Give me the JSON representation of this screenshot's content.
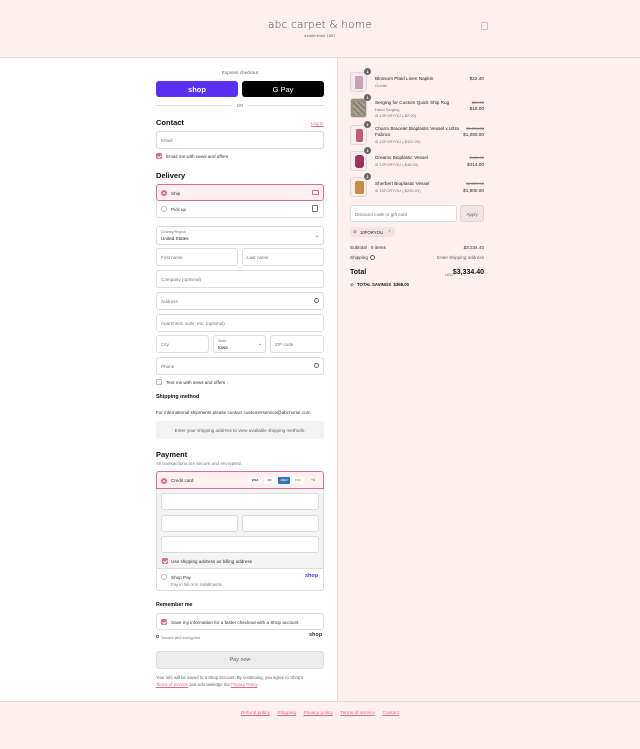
{
  "header": {
    "logo": "abc carpet & home",
    "tagline": "established 1897",
    "bag_icon": "bag-icon"
  },
  "express": {
    "title": "Express checkout",
    "shop_label": "shop",
    "gpay_label": "G Pay",
    "or_label": "OR"
  },
  "contact": {
    "title": "Contact",
    "login": "Log in",
    "email_placeholder": "Email",
    "news_label": "Email me with news and offers"
  },
  "delivery": {
    "title": "Delivery",
    "ship_label": "Ship",
    "pickup_label": "Pick up",
    "country_label": "Country/Region",
    "country_value": "United States",
    "first_name": "First name",
    "last_name": "Last name",
    "company": "Company (optional)",
    "address": "Address",
    "apartment": "Apartment, suite, etc. (optional)",
    "city": "City",
    "state_label": "State",
    "state_value": "Iowa",
    "zip": "ZIP code",
    "phone": "Phone",
    "text_label": "Text me with news and offers"
  },
  "shipping": {
    "title": "Shipping method",
    "note": "For international shipments please contact customerservice@abchome.com",
    "placeholder": "Enter your shipping address to view available shipping methods."
  },
  "payment": {
    "title": "Payment",
    "subtitle": "All transactions are secure and encrypted.",
    "credit_card": "Credit card",
    "card_badges": [
      "VISA",
      "MC",
      "AMEX",
      "DISC",
      "+4"
    ],
    "billing_label": "Use shipping address as billing address",
    "shop_pay": "Shop Pay",
    "shop_pay_sub": "Pay in full or in installments",
    "shop_pay_logo": "shop"
  },
  "remember": {
    "title": "Remember me",
    "save_label": "Save my information for a faster checkout with a Shop account",
    "secure": "Secure and encrypted",
    "shop_logo": "shop"
  },
  "pay_button": "Pay now",
  "legal": {
    "line1": "Your info will be saved to a Shop account. By continuing, you agree to Shop's",
    "tos": "Terms of Service",
    "and": " and acknowledge the ",
    "privacy": "Privacy Policy",
    "end": "."
  },
  "cart": {
    "items": [
      {
        "qty": "1",
        "name": "Blossom Plaid Linen Napkin",
        "name2": "",
        "sub": "Orchid",
        "tag": "",
        "price": "$22.40",
        "old_price": "",
        "thumb_color": "#c8a0b8"
      },
      {
        "qty": "1",
        "name": "Serging for Custom Quick Ship Rug",
        "name2": "",
        "sub": "Hand Serging",
        "tag": "10FORYOU (-$2.00)",
        "price": "$18.00",
        "old_price": "$20.00",
        "thumb_color": "#9a9384"
      },
      {
        "qty": "1",
        "name": "Charm Bracelet Bioplastic Vessel x Ultra",
        "name2": "Fabrics",
        "sub": "",
        "tag": "10FORYOU (-$120.00)",
        "price": "$1,080.00",
        "old_price": "$1,200.00",
        "thumb_color": "#c45a7a"
      },
      {
        "qty": "1",
        "name": "Dreams Bioplastic Vessel",
        "name2": "",
        "sub": "",
        "tag": "10FORYOU (-$46.00)",
        "price": "$414.00",
        "old_price": "$460.00",
        "thumb_color": "#a03060"
      },
      {
        "qty": "1",
        "name": "Sherbert Bioplastic Vessel",
        "name2": "",
        "sub": "",
        "tag": "10FORYOU (-$200.00)",
        "price": "$1,800.00",
        "old_price": "$2,000.00",
        "thumb_color": "#c98a4a"
      }
    ],
    "discount_placeholder": "Discount code or gift card",
    "apply": "Apply",
    "code": "10FORYOU",
    "subtotal_label": "Subtotal · 5 items",
    "subtotal_value": "$3,334.40",
    "shipping_label": "Shipping",
    "shipping_value": "Enter shipping address",
    "total_label": "Total",
    "currency": "USD",
    "total_value": "$3,334.40",
    "savings_label": "TOTAL SAVINGS",
    "savings_value": "$368.00"
  },
  "footer": {
    "links": [
      "Refund policy",
      "Shipping",
      "Privacy policy",
      "Terms of service",
      "Contact"
    ]
  },
  "colors": {
    "accent": "#e06a8a",
    "shop_purple": "#5a31f4",
    "panel_bg": "#fdf0ef"
  }
}
